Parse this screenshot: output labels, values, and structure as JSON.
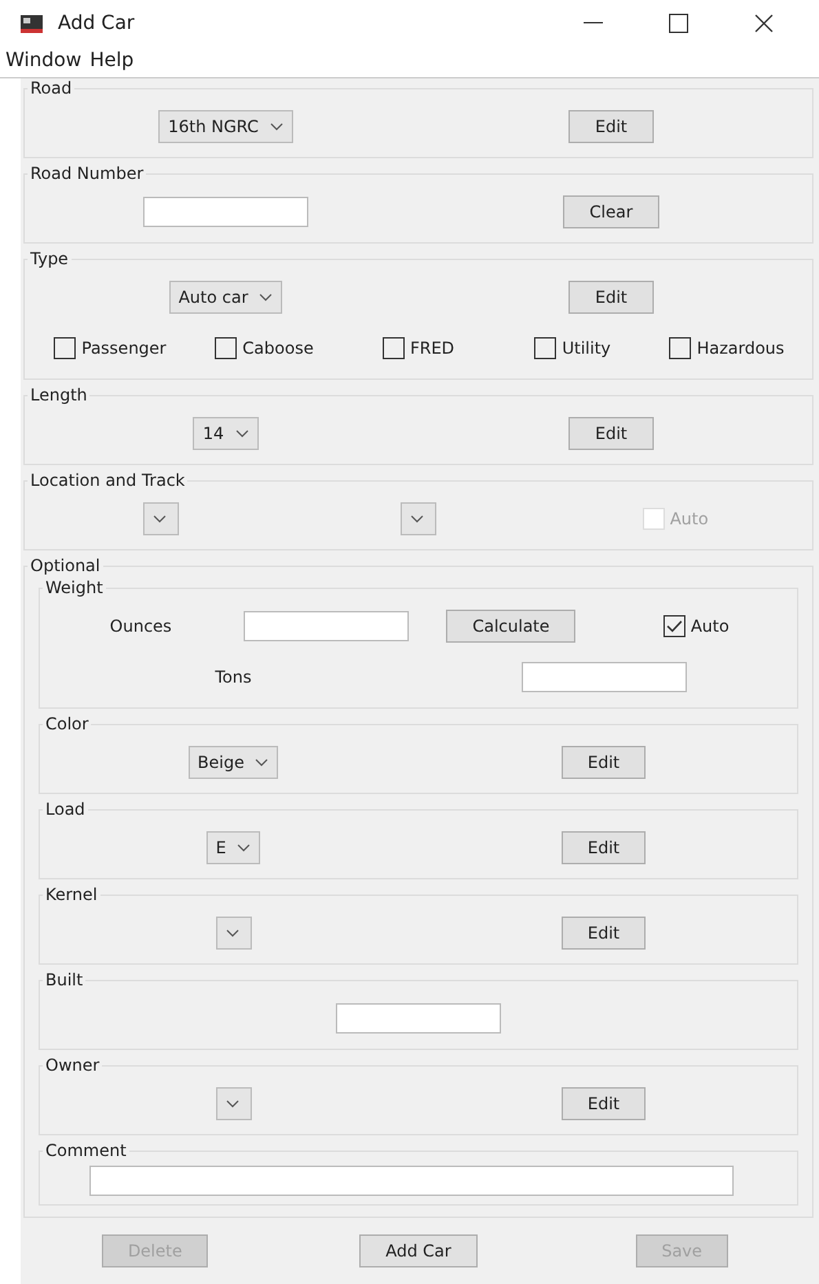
{
  "window": {
    "title": "Add Car"
  },
  "menu": [
    {
      "label": "Window"
    },
    {
      "label": "Help"
    }
  ],
  "sections": [
    {
      "title": "Road",
      "rows": [
        [
          {
            "kind": "combo",
            "value": "16th NGRC"
          },
          {
            "kind": "button",
            "label": "Edit",
            "disabled": false
          }
        ]
      ]
    },
    {
      "title": "Road Number",
      "rows": [
        [
          {
            "kind": "text"
          },
          {
            "kind": "button",
            "label": "Clear",
            "disabled": false
          }
        ]
      ]
    },
    {
      "title": "Type",
      "rows": [
        [
          {
            "kind": "combo",
            "value": "Auto car"
          },
          {
            "kind": "button",
            "label": "Edit",
            "disabled": false
          }
        ],
        [
          {
            "kind": "checkbox",
            "label": "Passenger",
            "checked": false,
            "disabled": false
          },
          {
            "kind": "checkbox",
            "label": "Caboose",
            "checked": false,
            "disabled": false
          },
          {
            "kind": "checkbox",
            "label": "FRED",
            "checked": false,
            "disabled": false
          },
          {
            "kind": "checkbox",
            "label": "Utility",
            "checked": false,
            "disabled": false
          },
          {
            "kind": "checkbox",
            "label": "Hazardous",
            "checked": false,
            "disabled": false
          }
        ]
      ]
    },
    {
      "title": "Length",
      "rows": [
        [
          {
            "kind": "combo",
            "value": "14"
          },
          {
            "kind": "button",
            "label": "Edit",
            "disabled": false
          }
        ]
      ]
    },
    {
      "title": "Location and Track",
      "rows": [
        [
          {
            "kind": "combo"
          },
          {
            "kind": "combo"
          },
          {
            "kind": "checkbox",
            "label": "Auto",
            "checked": false,
            "disabled": true
          }
        ]
      ]
    }
  ],
  "optional": {
    "title": "Optional",
    "sections": [
      {
        "title": "Weight",
        "rows": [
          [
            {
              "kind": "label",
              "text": "Ounces"
            },
            {
              "kind": "text"
            },
            {
              "kind": "button",
              "label": "Calculate",
              "disabled": false
            },
            {
              "kind": "checkbox",
              "label": "Auto",
              "checked": true,
              "disabled": false
            }
          ],
          [
            {
              "kind": "label",
              "text": "Tons"
            },
            {
              "kind": "text"
            }
          ]
        ]
      },
      {
        "title": "Color",
        "rows": [
          [
            {
              "kind": "combo",
              "value": "Beige"
            },
            {
              "kind": "button",
              "label": "Edit",
              "disabled": false
            }
          ]
        ]
      },
      {
        "title": "Load",
        "rows": [
          [
            {
              "kind": "combo",
              "value": "E"
            },
            {
              "kind": "button",
              "label": "Edit",
              "disabled": false
            }
          ]
        ]
      },
      {
        "title": "Kernel",
        "rows": [
          [
            {
              "kind": "combo"
            },
            {
              "kind": "button",
              "label": "Edit",
              "disabled": false
            }
          ]
        ]
      },
      {
        "title": "Built",
        "rows": [
          [
            {
              "kind": "text"
            }
          ]
        ]
      },
      {
        "title": "Owner",
        "rows": [
          [
            {
              "kind": "combo"
            },
            {
              "kind": "button",
              "label": "Edit",
              "disabled": false
            }
          ]
        ]
      },
      {
        "title": "Comment",
        "rows": [
          [
            {
              "kind": "line"
            }
          ]
        ]
      }
    ]
  },
  "actions": [
    {
      "label": "Delete",
      "disabled": true
    },
    {
      "label": "Add Car",
      "disabled": false
    },
    {
      "label": "Save",
      "disabled": true
    }
  ]
}
